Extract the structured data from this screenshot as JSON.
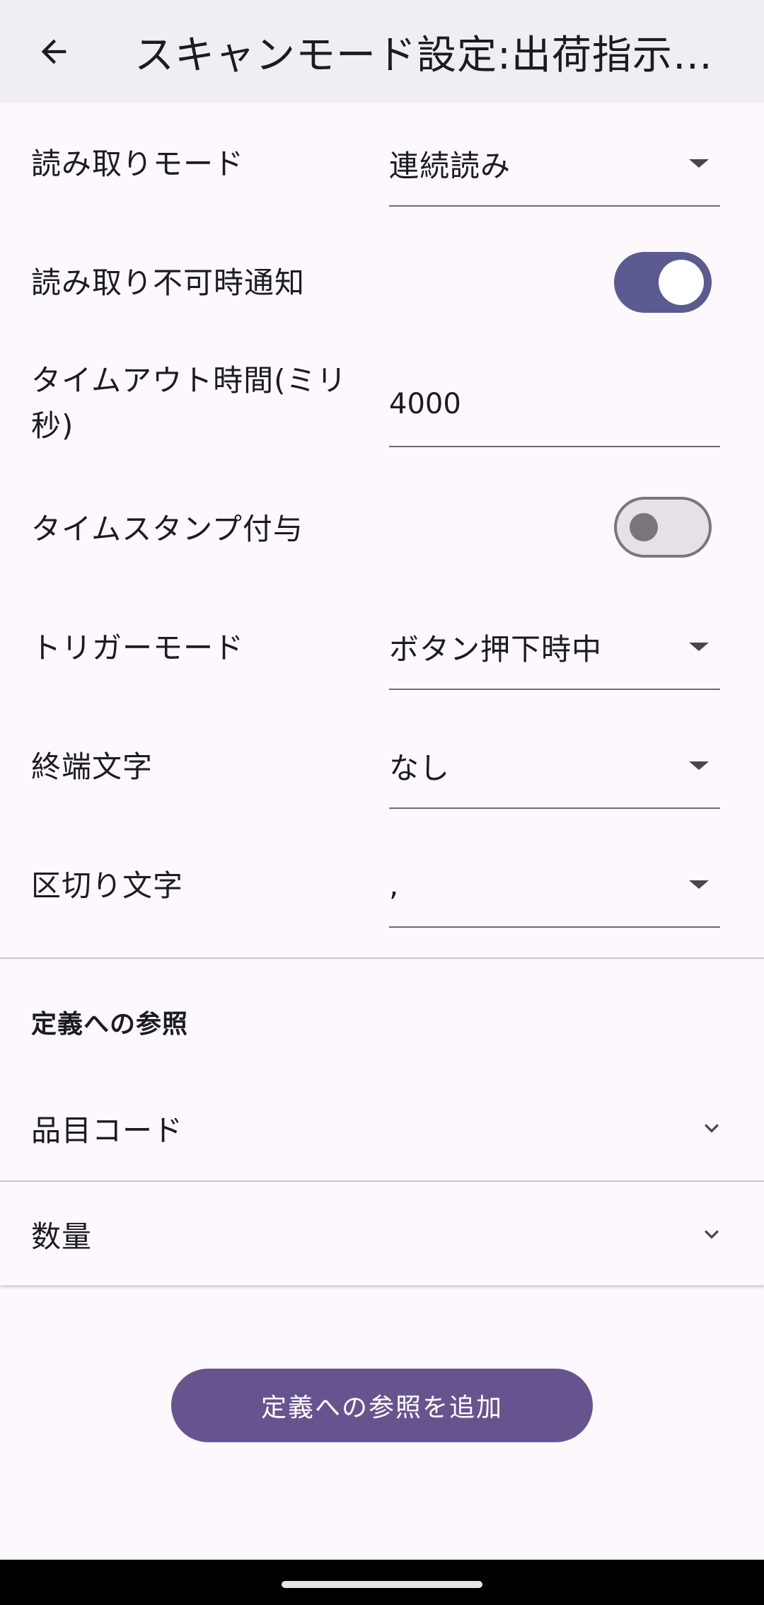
{
  "app_bar": {
    "title": "スキャンモード設定:出荷指示…"
  },
  "settings": {
    "read_mode": {
      "label": "読み取りモード",
      "value": "連続読み"
    },
    "unreadable_notify": {
      "label": "読み取り不可時通知",
      "checked": true
    },
    "timeout": {
      "label": "タイムアウト時間(ミリ秒)",
      "value": "4000"
    },
    "timestamp": {
      "label": "タイムスタンプ付与",
      "checked": false
    },
    "trigger_mode": {
      "label": "トリガーモード",
      "value": "ボタン押下時中"
    },
    "terminator": {
      "label": "終端文字",
      "value": "なし"
    },
    "separator": {
      "label": "区切り文字",
      "value": ","
    }
  },
  "definitions": {
    "header": "定義への参照",
    "items": [
      {
        "label": "品目コード"
      },
      {
        "label": "数量"
      }
    ],
    "add_button_label": "定義への参照を追加"
  },
  "colors": {
    "accent": "#67548e",
    "toggle_on": "#5b5a91",
    "background": "#fcf8fd",
    "appbar": "#f0eef2"
  }
}
